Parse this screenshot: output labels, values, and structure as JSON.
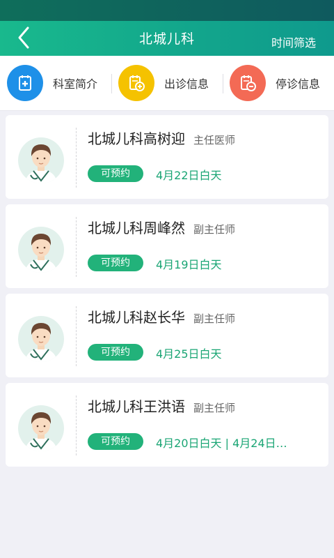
{
  "header": {
    "title": "北城儿科",
    "filter_label": "时间筛选"
  },
  "quick_actions": [
    {
      "label": "科室简介",
      "icon": "department-intro-icon",
      "color": "#1e90e8"
    },
    {
      "label": "出诊信息",
      "icon": "schedule-add-icon",
      "color": "#f5c200"
    },
    {
      "label": "停诊信息",
      "icon": "schedule-stop-icon",
      "color": "#f36a55"
    }
  ],
  "doctors": [
    {
      "name": "北城儿科高树迎",
      "rank": "主任医师",
      "status": "可预约",
      "dates": "4月22日白天"
    },
    {
      "name": "北城儿科周峰然",
      "rank": "副主任师",
      "status": "可预约",
      "dates": "4月19日白天"
    },
    {
      "name": "北城儿科赵长华",
      "rank": "副主任师",
      "status": "可预约",
      "dates": "4月25日白天"
    },
    {
      "name": "北城儿科王洪语",
      "rank": "副主任师",
      "status": "可预约",
      "dates": "4月20日白天 | 4月24日…"
    }
  ],
  "colors": {
    "accent": "#17b08a",
    "badge": "#22b27a",
    "date_text": "#1aa574"
  }
}
